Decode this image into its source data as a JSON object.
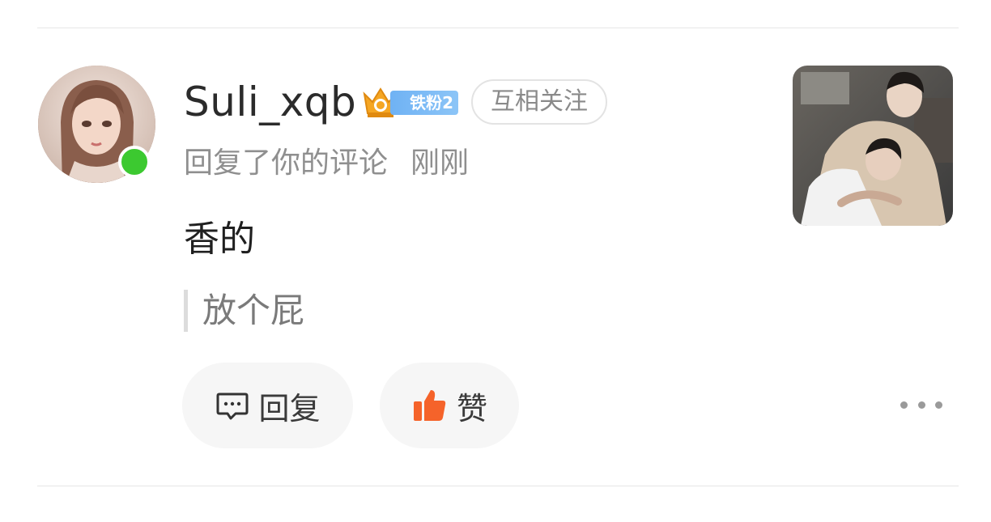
{
  "user": {
    "username": "Suli_xqb",
    "fan_badge_label": "铁粉2",
    "fan_badge_colors": [
      "#f5a623",
      "#6fb2f4"
    ],
    "follow_status": "互相关注",
    "online": true
  },
  "notification": {
    "action_text": "回复了你的评论",
    "time": "刚刚",
    "reply_text": "香的",
    "quoted_comment": "放个屁"
  },
  "actions": {
    "reply_label": "回复",
    "like_label": "赞",
    "like_icon_color": "#f5632a"
  },
  "icons": {
    "reply": "comment-bubble-icon",
    "like": "thumbs-up-icon",
    "more": "more-dots-icon",
    "badge": "crown-icon"
  }
}
